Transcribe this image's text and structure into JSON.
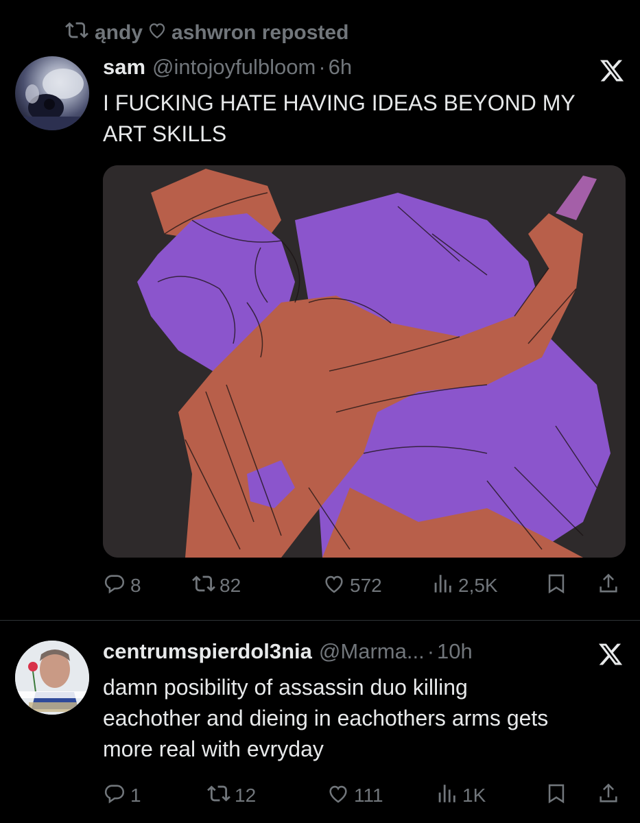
{
  "repost": {
    "reposter1": "ąndy",
    "reposter2": "ashwron reposted"
  },
  "tweet1": {
    "name": "sam",
    "handle": "@intojoyfulbloom",
    "separator": "·",
    "time": "6h",
    "text_line1": "I FUCKING HATE HAVING IDEAS BEYOND MY",
    "text_line2": "ART SKILLS",
    "actions": {
      "replies": "8",
      "reposts": "82",
      "likes": "572",
      "views": "2,5K"
    }
  },
  "tweet2": {
    "name": "centrumspierdol3nia",
    "handle": "@Marma...",
    "separator": "·",
    "time": "10h",
    "text_line1": "damn posibility of assassin duo killing",
    "text_line2": "eachother and dieing in eachothers arms gets",
    "text_line3": "more real with evryday",
    "actions": {
      "replies": "1",
      "reposts": "12",
      "likes": "111",
      "views": "1K"
    }
  },
  "colors": {
    "background": "#000000",
    "text": "#e7e9ea",
    "secondary": "#71767b",
    "divider": "#2f3336",
    "art_purple": "#8b55cc",
    "art_orange": "#b85f4a"
  },
  "icons": [
    "repost-icon",
    "heart-icon",
    "x-logo-icon",
    "reply-icon",
    "views-icon",
    "bookmark-icon",
    "share-icon"
  ]
}
